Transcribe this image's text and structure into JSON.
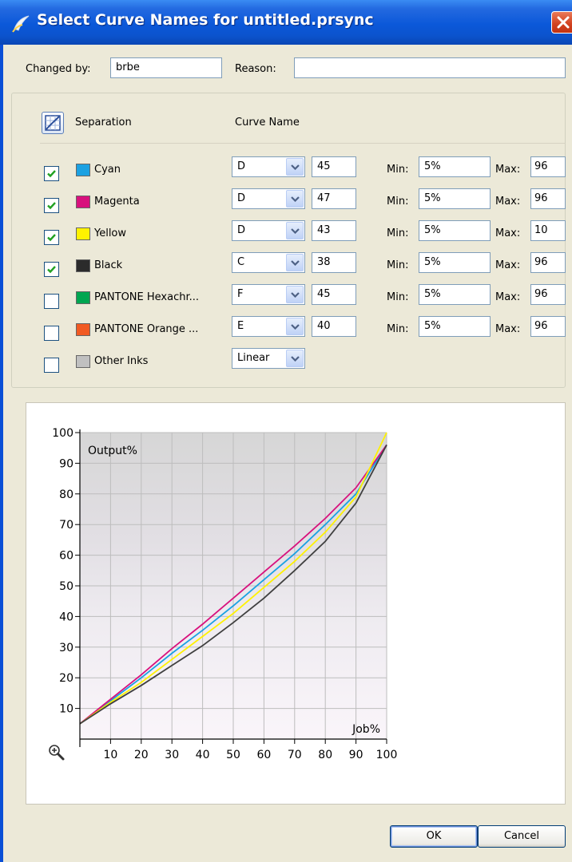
{
  "window": {
    "title": "Select Curve Names for untitled.prsync"
  },
  "header": {
    "changed_by_label": "Changed by:",
    "changed_by_value": "brbe",
    "reason_label": "Reason:",
    "reason_value": ""
  },
  "columns": {
    "separation": "Separation",
    "curve_name": "Curve Name"
  },
  "min_label": "Min:",
  "max_label": "Max:",
  "separations": [
    {
      "name": "Cyan",
      "color": "#1BA1E2",
      "checked": true,
      "curve": "D",
      "number": "45",
      "min": "5%",
      "max": "96"
    },
    {
      "name": "Magenta",
      "color": "#D8117D",
      "checked": true,
      "curve": "D",
      "number": "47",
      "min": "5%",
      "max": "96"
    },
    {
      "name": "Yellow",
      "color": "#FFF200",
      "checked": true,
      "curve": "D",
      "number": "43",
      "min": "5%",
      "max": "10"
    },
    {
      "name": "Black",
      "color": "#2B2B2B",
      "checked": true,
      "curve": "C",
      "number": "38",
      "min": "5%",
      "max": "96"
    },
    {
      "name": "PANTONE Hexachr...",
      "color": "#00A651",
      "checked": false,
      "curve": "F",
      "number": "45",
      "min": "5%",
      "max": "96"
    },
    {
      "name": "PANTONE Orange ...",
      "color": "#F15A22",
      "checked": false,
      "curve": "E",
      "number": "40",
      "min": "5%",
      "max": "96"
    }
  ],
  "other_inks": {
    "name": "Other Inks",
    "color": "#C0C0C0",
    "checked": false,
    "curve": "Linear"
  },
  "chart_data": {
    "type": "line",
    "title": "",
    "xlabel": "Job%",
    "ylabel": "Output%",
    "xlim": [
      0,
      100
    ],
    "ylim": [
      0,
      100
    ],
    "x_ticks": [
      "10",
      "20",
      "30",
      "40",
      "50",
      "60",
      "70",
      "80",
      "90",
      "100"
    ],
    "y_ticks": [
      "10",
      "20",
      "30",
      "40",
      "50",
      "60",
      "70",
      "80",
      "90",
      "100"
    ],
    "grid": true,
    "x": [
      0,
      10,
      20,
      30,
      40,
      50,
      60,
      70,
      80,
      90,
      100
    ],
    "series": [
      {
        "name": "Cyan",
        "color": "#1BA1E2",
        "values": [
          5,
          12.5,
          20,
          28,
          35.5,
          43.5,
          52,
          60.5,
          70,
          80,
          96
        ]
      },
      {
        "name": "Magenta",
        "color": "#D8117D",
        "values": [
          5,
          13,
          21,
          29.5,
          37.5,
          46,
          54.5,
          63,
          72,
          82,
          96
        ]
      },
      {
        "name": "Yellow",
        "color": "#FFF200",
        "values": [
          5,
          12,
          18.5,
          26,
          33.5,
          41,
          49.5,
          58,
          67.5,
          79,
          100
        ]
      },
      {
        "name": "Black",
        "color": "#404040",
        "values": [
          5,
          11.5,
          17.5,
          24,
          30.5,
          38,
          46,
          55,
          64.5,
          77,
          96
        ]
      }
    ]
  },
  "zoom_icon": "zoom-in-icon",
  "buttons": {
    "ok": "OK",
    "cancel": "Cancel"
  }
}
